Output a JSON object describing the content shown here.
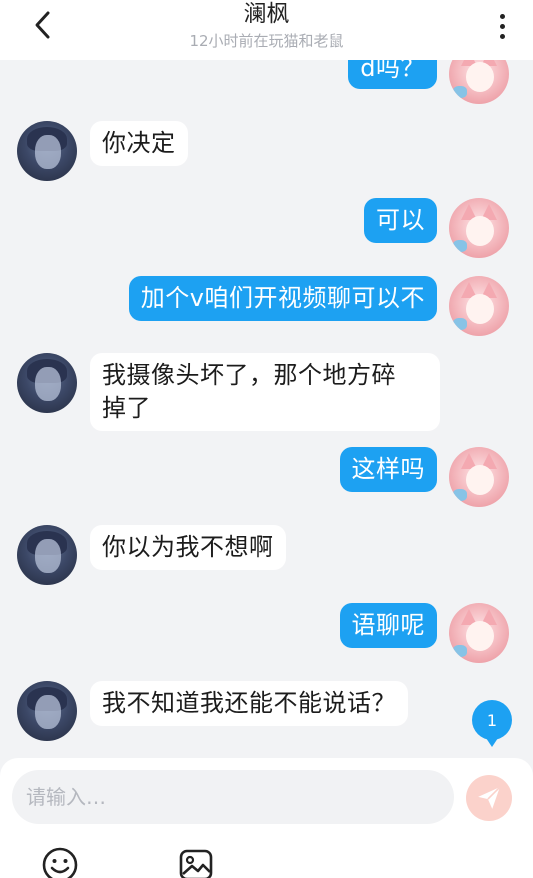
{
  "header": {
    "title": "澜枫",
    "status": "12小时前在玩猫和老鼠"
  },
  "messages": [
    {
      "from": "me",
      "text": "d吗？"
    },
    {
      "from": "other",
      "text": "你决定"
    },
    {
      "from": "me",
      "text": "可以"
    },
    {
      "from": "me",
      "text": "加个v咱们开视频聊可以不"
    },
    {
      "from": "other",
      "text": "我摄像头坏了，那个地方碎",
      "text2": "掉了"
    },
    {
      "from": "me",
      "text": "这样吗"
    },
    {
      "from": "other",
      "text": "你以为我不想啊"
    },
    {
      "from": "me",
      "text": "语聊呢"
    },
    {
      "from": "other",
      "text": "我不知道我还能不能说话？"
    }
  ],
  "unread_badge": "1",
  "composer": {
    "placeholder": "请输入…"
  },
  "colors": {
    "accent": "#1da1f2",
    "background": "#f2f3f5",
    "send_button": "#fbd2cb"
  },
  "icons": {
    "back": "chevron-left-icon",
    "more": "more-vertical-icon",
    "send": "paper-plane-icon",
    "emoji": "emoji-icon",
    "image": "image-icon"
  }
}
